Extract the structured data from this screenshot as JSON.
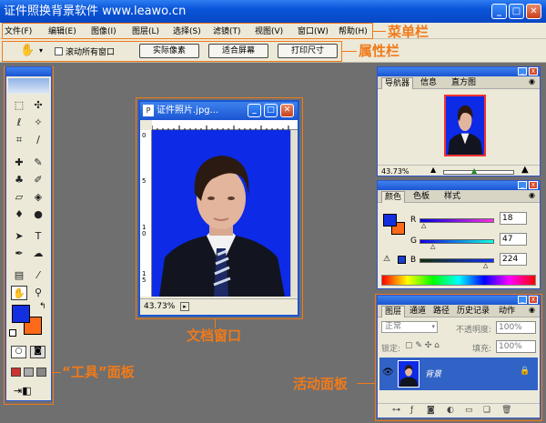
{
  "window": {
    "title": "证件照换背景软件 www.leawo.cn"
  },
  "menu": {
    "items": [
      "文件(F)",
      "编辑(E)",
      "图像(I)",
      "图层(L)",
      "选择(S)",
      "滤镜(T)",
      "视图(V)",
      "窗口(W)",
      "帮助(H)"
    ]
  },
  "options": {
    "scroll_all": "滚动所有窗口",
    "actual_pixels": "实际像素",
    "fit_screen": "适合屏幕",
    "print_size": "打印尺寸"
  },
  "annotations": {
    "menubar": "菜单栏",
    "optionsbar": "属性栏",
    "toolbox": "“工具”面板",
    "docwindow": "文档窗口",
    "active_panel": "活动面板"
  },
  "document": {
    "title": "证件照片.jpg...",
    "zoom": "43.73%",
    "ruler_marks": [
      "0",
      "5",
      "1 0",
      "1 5"
    ]
  },
  "navigator": {
    "tabs": [
      "导航器",
      "信息",
      "直方图"
    ],
    "zoom": "43.73%"
  },
  "color_panel": {
    "tabs": [
      "颜色",
      "色板",
      "样式"
    ],
    "channels": [
      {
        "label": "R",
        "value": "18"
      },
      {
        "label": "G",
        "value": "47"
      },
      {
        "label": "B",
        "value": "224"
      }
    ],
    "fg_color": "#122fe0",
    "bg_color": "#ff6a1a"
  },
  "layers_panel": {
    "tabs": [
      "图层",
      "通道",
      "路径",
      "历史记录",
      "动作"
    ],
    "blend_mode": "正常",
    "opacity_label": "不透明度:",
    "opacity": "100%",
    "lock_label": "锁定:",
    "fill_label": "填充:",
    "fill": "100%",
    "layer_name": "背景"
  },
  "colors": {
    "accent": "#f07a1a",
    "titlebar": "#0a55d9",
    "photo_bg": "#0d2ae6"
  }
}
